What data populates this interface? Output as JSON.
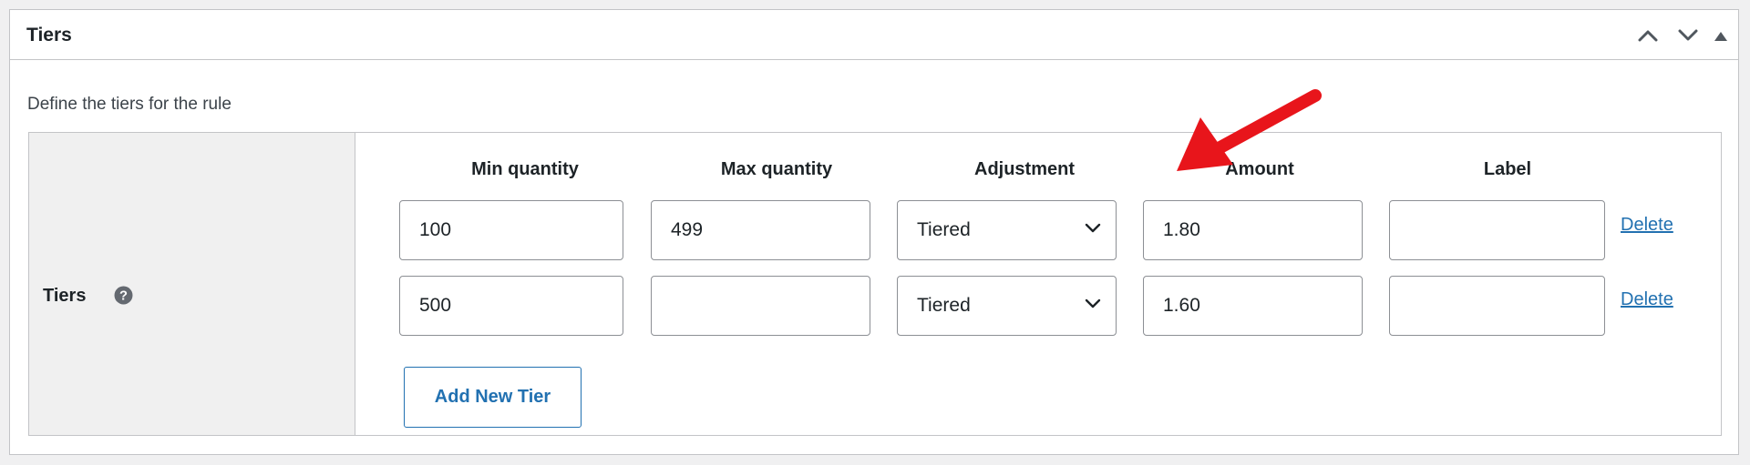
{
  "panel": {
    "title": "Tiers",
    "description": "Define the tiers for the rule"
  },
  "field": {
    "label": "Tiers",
    "help_icon": "help-icon"
  },
  "columns": [
    "Min quantity",
    "Max quantity",
    "Adjustment",
    "Amount",
    "Label"
  ],
  "rows": [
    {
      "min": "100",
      "max": "499",
      "adjustment": "Tiered",
      "amount": "1.80",
      "label": "",
      "delete": "Delete"
    },
    {
      "min": "500",
      "max": "",
      "adjustment": "Tiered",
      "amount": "1.60",
      "label": "",
      "delete": "Delete"
    }
  ],
  "add_button": "Add New Tier",
  "header_icons": [
    "chevron-up-icon",
    "chevron-down-icon",
    "toggle-triangle-icon"
  ],
  "colors": {
    "accent": "#2271b1",
    "border": "#c3c4c7",
    "label_bg": "#f0f0f0",
    "annotation_arrow": "#e8151b"
  }
}
